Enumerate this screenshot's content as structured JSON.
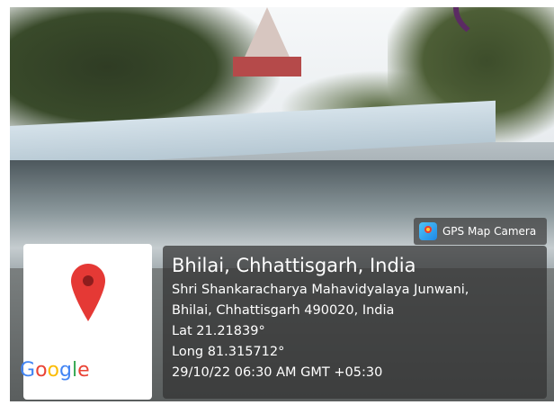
{
  "gps_badge": {
    "label": "GPS Map Camera",
    "icon": "gps-map-camera-icon"
  },
  "location": {
    "city": "Bhilai, Chhattisgarh, India",
    "address_line1": "Shri Shankaracharya Mahavidyalaya Junwani,",
    "address_line2": "Bhilai, Chhattisgarh 490020, India",
    "lat": "Lat 21.21839°",
    "long": "Long 81.315712°",
    "datetime": "29/10/22 06:30 AM GMT +05:30"
  },
  "map": {
    "pin_icon": "map-pin-icon",
    "pin_color": "#e53935",
    "logo_text": [
      "G",
      "o",
      "o",
      "g",
      "l",
      "e"
    ]
  },
  "colors": {
    "panel_bg": "#323232",
    "text": "#ffffff"
  }
}
